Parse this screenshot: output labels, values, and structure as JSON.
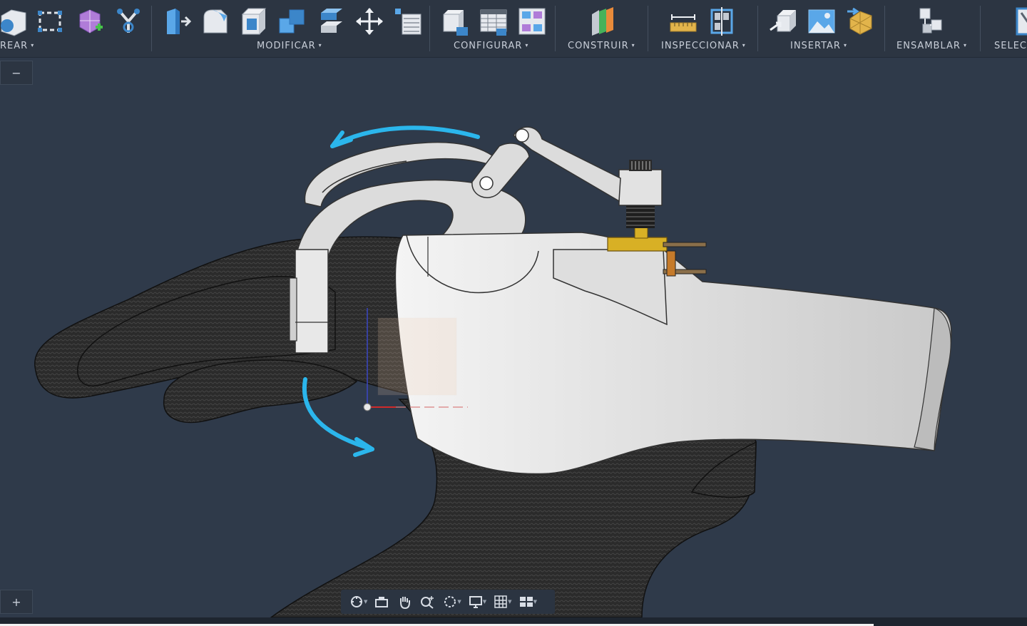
{
  "toolbar": {
    "groups": [
      {
        "label": "REAR",
        "caret": "▾"
      },
      {
        "label": "MODIFICAR",
        "caret": "▾"
      },
      {
        "label": "CONFIGURAR",
        "caret": "▾"
      },
      {
        "label": "CONSTRUIR",
        "caret": "▾"
      },
      {
        "label": "INSPECCIONAR",
        "caret": "▾"
      },
      {
        "label": "INSERTAR",
        "caret": "▾"
      },
      {
        "label": "ENSAMBLAR",
        "caret": "▾"
      },
      {
        "label": "SELECC",
        "caret": ""
      }
    ]
  },
  "side": {
    "collapse": "−",
    "expand": "+"
  },
  "colors": {
    "background": "#2f3a4a",
    "toolbar": "#2c3542",
    "annotation": "#2bb6ec",
    "part": "#dcdcdc",
    "servo": "#d8b025",
    "hand_mesh": "#2a2a2a"
  },
  "navbar": {
    "items": [
      "orbit-icon",
      "look-at-icon",
      "pan-icon",
      "zoom-icon",
      "fit-icon",
      "display-icon",
      "grid-icon",
      "viewports-icon"
    ]
  }
}
